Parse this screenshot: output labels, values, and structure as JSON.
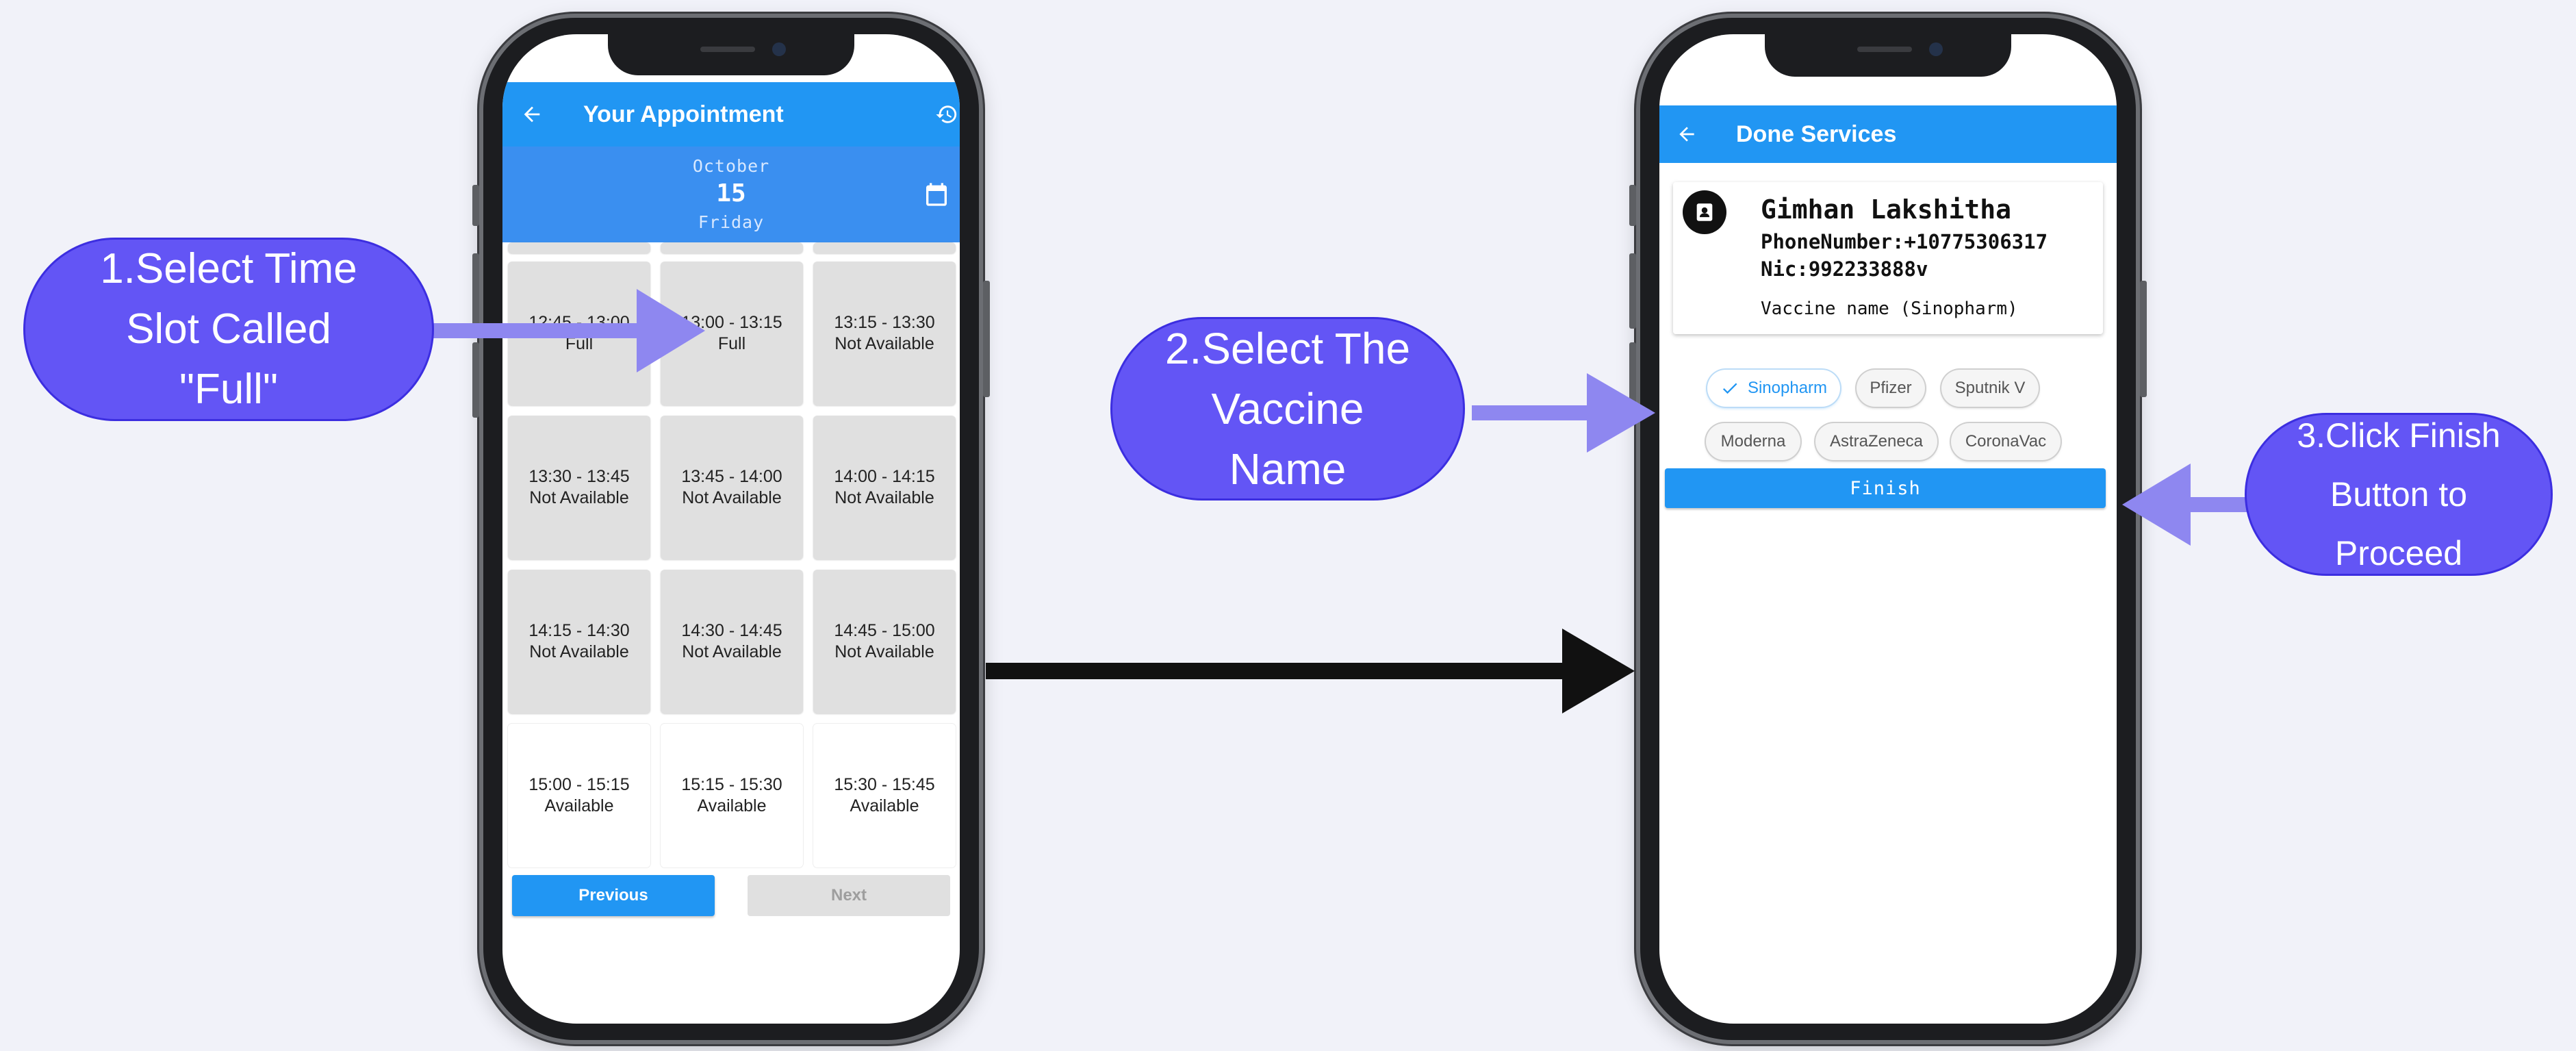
{
  "steps": {
    "step1": "1.Select Time\nSlot Called\n\"Full\"",
    "step2": "2.Select The\nVaccine\nName",
    "step3": "3.Click Finish\nButton to\nProceed"
  },
  "appointment_screen": {
    "title": "Your Appointment",
    "back_icon": "arrow-left-icon",
    "history_icon": "history-icon",
    "calendar_icon": "calendar-icon",
    "date": {
      "month": "October",
      "day": "15",
      "weekday": "Friday"
    },
    "slots": [
      {
        "time": "12:45 - 13:00",
        "status": "Full"
      },
      {
        "time": "13:00 - 13:15",
        "status": "Full"
      },
      {
        "time": "13:15 - 13:30",
        "status": "Not Available"
      },
      {
        "time": "13:30 - 13:45",
        "status": "Not Available"
      },
      {
        "time": "13:45 - 14:00",
        "status": "Not Available"
      },
      {
        "time": "14:00 - 14:15",
        "status": "Not Available"
      },
      {
        "time": "14:15 - 14:30",
        "status": "Not Available"
      },
      {
        "time": "14:30 - 14:45",
        "status": "Not Available"
      },
      {
        "time": "14:45 - 15:00",
        "status": "Not Available"
      },
      {
        "time": "15:00 - 15:15",
        "status": "Available"
      },
      {
        "time": "15:15 - 15:30",
        "status": "Available"
      },
      {
        "time": "15:30 - 15:45",
        "status": "Available"
      }
    ],
    "previous_label": "Previous",
    "next_label": "Next",
    "colors": {
      "appbar": "#2196f3",
      "datebar": "#3a8ff0",
      "slot_unavailable": "#e0e0e0"
    }
  },
  "done_screen": {
    "title": "Done Services",
    "back_icon": "arrow-left-icon",
    "avatar_icon": "contact-icon",
    "name": "Gimhan Lakshitha",
    "phone": "PhoneNumber:+10775306317",
    "nic": "Nic:992233888v",
    "vaccine": "Vaccine name (Sinopharm)",
    "chips": [
      "Sinopharm",
      "Pfizer",
      "Sputnik V",
      "Moderna",
      "AstraZeneca",
      "CoronaVac"
    ],
    "selected_chip": "Sinopharm",
    "check_icon": "check-icon",
    "finish_label": "Finish"
  },
  "colors": {
    "callout": "#6355f5",
    "arrow_light": "#8e87f0",
    "arrow_dark": "#111111"
  }
}
